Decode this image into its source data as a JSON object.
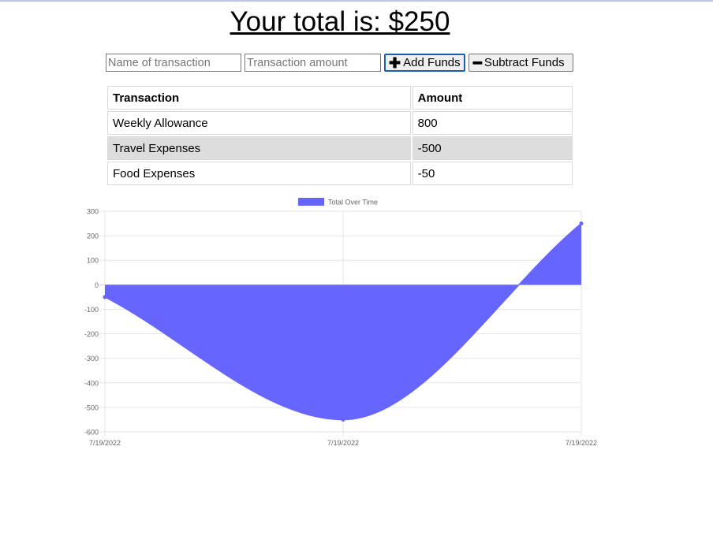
{
  "header": {
    "total_text": "Your total is: $250"
  },
  "form": {
    "name_placeholder": "Name of transaction",
    "amount_placeholder": "Transaction amount",
    "add_label": "Add Funds",
    "subtract_label": "Subtract Funds"
  },
  "table": {
    "columns": [
      "Transaction",
      "Amount"
    ],
    "rows": [
      [
        "Weekly Allowance",
        "800"
      ],
      [
        "Travel Expenses",
        "-500"
      ],
      [
        "Food Expenses",
        "-50"
      ]
    ]
  },
  "colors": {
    "series": "#6666ff",
    "grid": "#e6e6e6",
    "axis_text": "#666666"
  },
  "chart_data": {
    "type": "area",
    "title": "",
    "legend": {
      "position": "top",
      "entries": [
        "Total Over Time"
      ]
    },
    "x": [
      "7/19/2022",
      "7/19/2022",
      "7/19/2022"
    ],
    "series": [
      {
        "name": "Total Over Time",
        "values": [
          -50,
          -550,
          250
        ]
      }
    ],
    "ylim": [
      -600,
      300
    ],
    "yticks": [
      300,
      200,
      100,
      0,
      -100,
      -200,
      -300,
      -400,
      -500,
      -600
    ],
    "grid": true,
    "xlabel": "",
    "ylabel": ""
  }
}
